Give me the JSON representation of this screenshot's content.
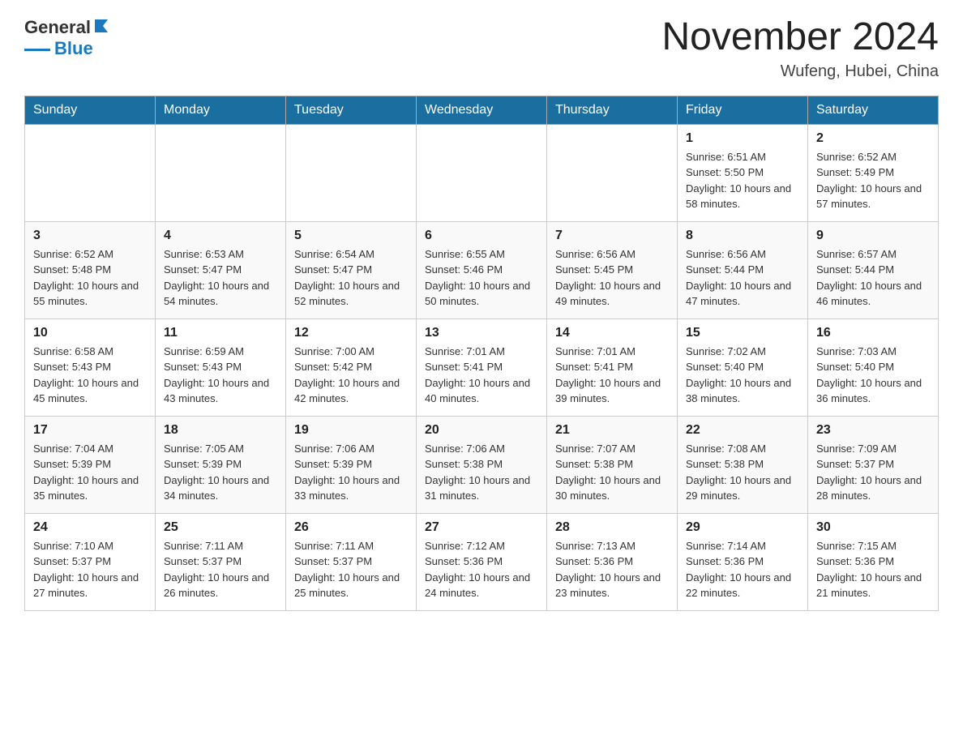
{
  "header": {
    "logo_general": "General",
    "logo_blue": "Blue",
    "month_title": "November 2024",
    "subtitle": "Wufeng, Hubei, China"
  },
  "days_of_week": [
    "Sunday",
    "Monday",
    "Tuesday",
    "Wednesday",
    "Thursday",
    "Friday",
    "Saturday"
  ],
  "weeks": [
    [
      {
        "day": "",
        "info": ""
      },
      {
        "day": "",
        "info": ""
      },
      {
        "day": "",
        "info": ""
      },
      {
        "day": "",
        "info": ""
      },
      {
        "day": "",
        "info": ""
      },
      {
        "day": "1",
        "info": "Sunrise: 6:51 AM\nSunset: 5:50 PM\nDaylight: 10 hours and 58 minutes."
      },
      {
        "day": "2",
        "info": "Sunrise: 6:52 AM\nSunset: 5:49 PM\nDaylight: 10 hours and 57 minutes."
      }
    ],
    [
      {
        "day": "3",
        "info": "Sunrise: 6:52 AM\nSunset: 5:48 PM\nDaylight: 10 hours and 55 minutes."
      },
      {
        "day": "4",
        "info": "Sunrise: 6:53 AM\nSunset: 5:47 PM\nDaylight: 10 hours and 54 minutes."
      },
      {
        "day": "5",
        "info": "Sunrise: 6:54 AM\nSunset: 5:47 PM\nDaylight: 10 hours and 52 minutes."
      },
      {
        "day": "6",
        "info": "Sunrise: 6:55 AM\nSunset: 5:46 PM\nDaylight: 10 hours and 50 minutes."
      },
      {
        "day": "7",
        "info": "Sunrise: 6:56 AM\nSunset: 5:45 PM\nDaylight: 10 hours and 49 minutes."
      },
      {
        "day": "8",
        "info": "Sunrise: 6:56 AM\nSunset: 5:44 PM\nDaylight: 10 hours and 47 minutes."
      },
      {
        "day": "9",
        "info": "Sunrise: 6:57 AM\nSunset: 5:44 PM\nDaylight: 10 hours and 46 minutes."
      }
    ],
    [
      {
        "day": "10",
        "info": "Sunrise: 6:58 AM\nSunset: 5:43 PM\nDaylight: 10 hours and 45 minutes."
      },
      {
        "day": "11",
        "info": "Sunrise: 6:59 AM\nSunset: 5:43 PM\nDaylight: 10 hours and 43 minutes."
      },
      {
        "day": "12",
        "info": "Sunrise: 7:00 AM\nSunset: 5:42 PM\nDaylight: 10 hours and 42 minutes."
      },
      {
        "day": "13",
        "info": "Sunrise: 7:01 AM\nSunset: 5:41 PM\nDaylight: 10 hours and 40 minutes."
      },
      {
        "day": "14",
        "info": "Sunrise: 7:01 AM\nSunset: 5:41 PM\nDaylight: 10 hours and 39 minutes."
      },
      {
        "day": "15",
        "info": "Sunrise: 7:02 AM\nSunset: 5:40 PM\nDaylight: 10 hours and 38 minutes."
      },
      {
        "day": "16",
        "info": "Sunrise: 7:03 AM\nSunset: 5:40 PM\nDaylight: 10 hours and 36 minutes."
      }
    ],
    [
      {
        "day": "17",
        "info": "Sunrise: 7:04 AM\nSunset: 5:39 PM\nDaylight: 10 hours and 35 minutes."
      },
      {
        "day": "18",
        "info": "Sunrise: 7:05 AM\nSunset: 5:39 PM\nDaylight: 10 hours and 34 minutes."
      },
      {
        "day": "19",
        "info": "Sunrise: 7:06 AM\nSunset: 5:39 PM\nDaylight: 10 hours and 33 minutes."
      },
      {
        "day": "20",
        "info": "Sunrise: 7:06 AM\nSunset: 5:38 PM\nDaylight: 10 hours and 31 minutes."
      },
      {
        "day": "21",
        "info": "Sunrise: 7:07 AM\nSunset: 5:38 PM\nDaylight: 10 hours and 30 minutes."
      },
      {
        "day": "22",
        "info": "Sunrise: 7:08 AM\nSunset: 5:38 PM\nDaylight: 10 hours and 29 minutes."
      },
      {
        "day": "23",
        "info": "Sunrise: 7:09 AM\nSunset: 5:37 PM\nDaylight: 10 hours and 28 minutes."
      }
    ],
    [
      {
        "day": "24",
        "info": "Sunrise: 7:10 AM\nSunset: 5:37 PM\nDaylight: 10 hours and 27 minutes."
      },
      {
        "day": "25",
        "info": "Sunrise: 7:11 AM\nSunset: 5:37 PM\nDaylight: 10 hours and 26 minutes."
      },
      {
        "day": "26",
        "info": "Sunrise: 7:11 AM\nSunset: 5:37 PM\nDaylight: 10 hours and 25 minutes."
      },
      {
        "day": "27",
        "info": "Sunrise: 7:12 AM\nSunset: 5:36 PM\nDaylight: 10 hours and 24 minutes."
      },
      {
        "day": "28",
        "info": "Sunrise: 7:13 AM\nSunset: 5:36 PM\nDaylight: 10 hours and 23 minutes."
      },
      {
        "day": "29",
        "info": "Sunrise: 7:14 AM\nSunset: 5:36 PM\nDaylight: 10 hours and 22 minutes."
      },
      {
        "day": "30",
        "info": "Sunrise: 7:15 AM\nSunset: 5:36 PM\nDaylight: 10 hours and 21 minutes."
      }
    ]
  ]
}
